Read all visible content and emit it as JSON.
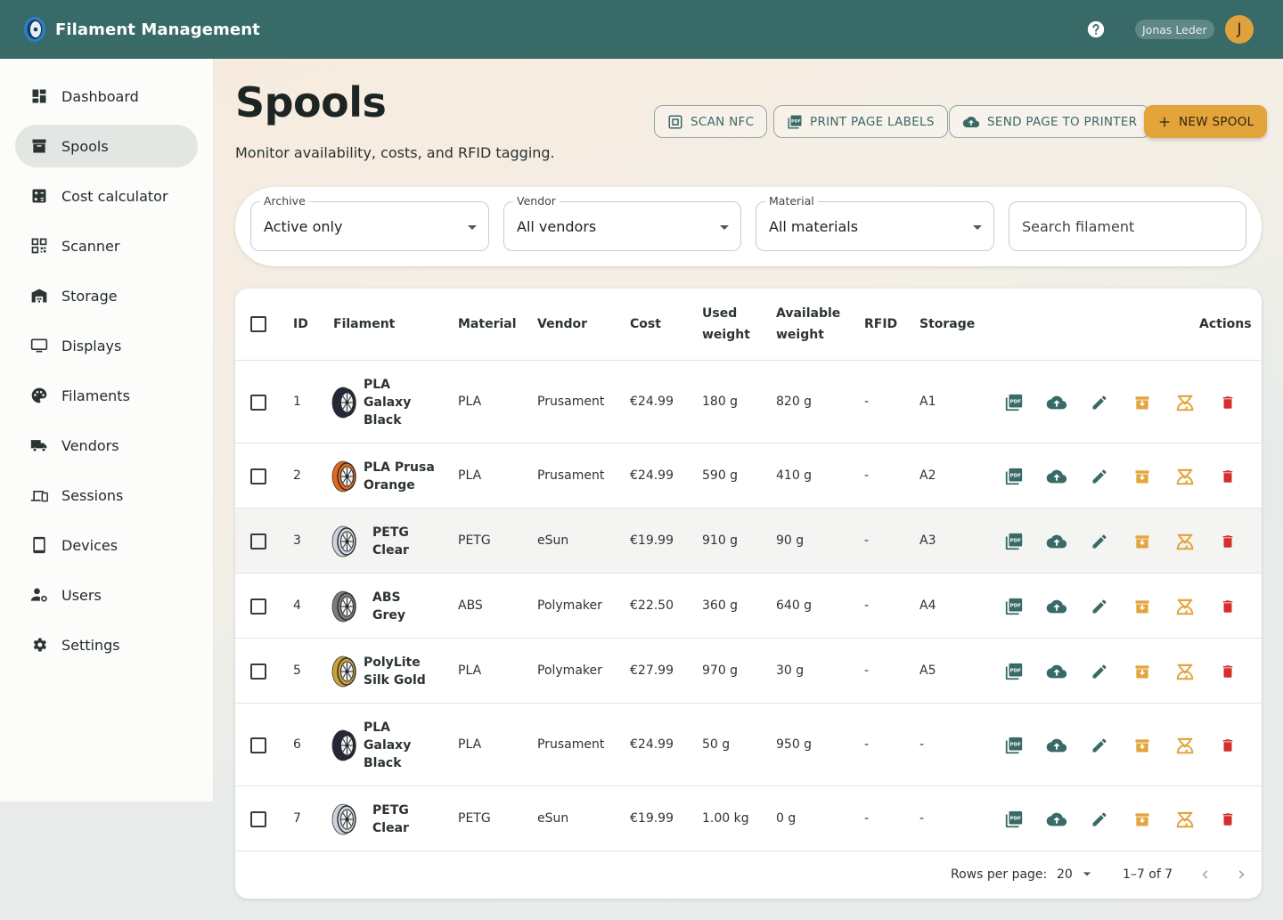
{
  "app": {
    "title": "Filament Management",
    "user_name": "Jonas Leder",
    "avatar_initial": "J"
  },
  "sidebar": {
    "items": [
      {
        "label": "Dashboard",
        "icon": "dashboard-icon"
      },
      {
        "label": "Spools",
        "icon": "archive-box-icon",
        "active": true
      },
      {
        "label": "Cost calculator",
        "icon": "calculator-icon"
      },
      {
        "label": "Scanner",
        "icon": "qr-scanner-icon"
      },
      {
        "label": "Storage",
        "icon": "warehouse-icon"
      },
      {
        "label": "Displays",
        "icon": "monitor-icon"
      },
      {
        "label": "Filaments",
        "icon": "palette-icon"
      },
      {
        "label": "Vendors",
        "icon": "truck-icon"
      },
      {
        "label": "Sessions",
        "icon": "devices-icon"
      },
      {
        "label": "Devices",
        "icon": "tablet-icon"
      },
      {
        "label": "Users",
        "icon": "user-settings-icon"
      },
      {
        "label": "Settings",
        "icon": "gear-icon"
      }
    ]
  },
  "page": {
    "title": "Spools",
    "subtitle": "Monitor availability, costs, and RFID tagging."
  },
  "toolbar": {
    "scan_nfc": "SCAN NFC",
    "print_labels": "PRINT PAGE LABELS",
    "send_to_printer": "SEND PAGE TO PRINTER",
    "new_spool": "NEW SPOOL"
  },
  "filters": {
    "archive": {
      "label": "Archive",
      "value": "Active only"
    },
    "vendor": {
      "label": "Vendor",
      "value": "All vendors"
    },
    "material": {
      "label": "Material",
      "value": "All materials"
    },
    "search": {
      "placeholder": "Search filament"
    }
  },
  "table": {
    "headers": {
      "id": "ID",
      "filament": "Filament",
      "material": "Material",
      "vendor": "Vendor",
      "cost": "Cost",
      "used_1": "Used",
      "used_2": "weight",
      "avail_1": "Available",
      "avail_2": "weight",
      "rfid": "RFID",
      "storage": "Storage",
      "actions": "Actions"
    },
    "rows": [
      {
        "id": "1",
        "name": [
          "PLA",
          "Galaxy",
          "Black"
        ],
        "material": "PLA",
        "vendor": "Prusament",
        "cost": "€24.99",
        "used": "180 g",
        "available": "820 g",
        "rfid": "-",
        "storage": "A1",
        "color": "#23273a"
      },
      {
        "id": "2",
        "name": [
          "PLA Prusa",
          "Orange"
        ],
        "material": "PLA",
        "vendor": "Prusament",
        "cost": "€24.99",
        "used": "590 g",
        "available": "410 g",
        "rfid": "-",
        "storage": "A2",
        "color": "#e2691d"
      },
      {
        "id": "3",
        "name": [
          "PETG",
          "Clear"
        ],
        "material": "PETG",
        "vendor": "eSun",
        "cost": "€19.99",
        "used": "910 g",
        "available": "90 g",
        "rfid": "-",
        "storage": "A3",
        "color": "#cdd3de"
      },
      {
        "id": "4",
        "name": [
          "ABS",
          "Grey"
        ],
        "material": "ABS",
        "vendor": "Polymaker",
        "cost": "€22.50",
        "used": "360 g",
        "available": "640 g",
        "rfid": "-",
        "storage": "A4",
        "color": "#7c7c7c"
      },
      {
        "id": "5",
        "name": [
          "PolyLite",
          "Silk Gold"
        ],
        "material": "PLA",
        "vendor": "Polymaker",
        "cost": "€27.99",
        "used": "970 g",
        "available": "30 g",
        "rfid": "-",
        "storage": "A5",
        "color": "#c9a23a"
      },
      {
        "id": "6",
        "name": [
          "PLA",
          "Galaxy",
          "Black"
        ],
        "material": "PLA",
        "vendor": "Prusament",
        "cost": "€24.99",
        "used": "50 g",
        "available": "950 g",
        "rfid": "-",
        "storage": "-",
        "color": "#23273a"
      },
      {
        "id": "7",
        "name": [
          "PETG",
          "Clear"
        ],
        "material": "PETG",
        "vendor": "eSun",
        "cost": "€19.99",
        "used": "1.00 kg",
        "available": "0 g",
        "rfid": "-",
        "storage": "-",
        "color": "#cdd3de"
      }
    ],
    "row_actions": [
      "pdf-label-icon",
      "cloud-upload-icon",
      "edit-pencil-icon",
      "archive-icon",
      "scale-icon",
      "delete-icon"
    ]
  },
  "pagination": {
    "rows_per_page_label": "Rows per page:",
    "rows_per_page": "20",
    "range": "1–7 of 7"
  },
  "colors": {
    "appbar": "#386a67",
    "accent": "#e3a43b",
    "delete": "#d32f2f",
    "archive": "#e3a43b"
  }
}
